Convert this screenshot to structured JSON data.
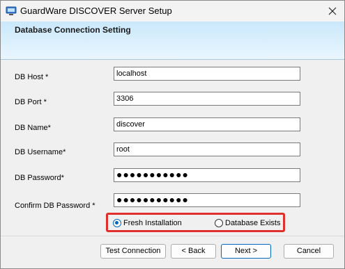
{
  "window": {
    "title": "GuardWare DISCOVER Server Setup",
    "header_title": "Database Connection Setting"
  },
  "form": {
    "host_label": "DB Host *",
    "host_value": "localhost",
    "port_label": "DB Port *",
    "port_value": "3306",
    "name_label": "DB Name*",
    "name_value": "discover",
    "username_label": "DB Username*",
    "username_value": "root",
    "password_label": "DB Password*",
    "password_value": "●●●●●●●●●●●",
    "confirm_label": "Confirm DB Password *",
    "confirm_value": "●●●●●●●●●●●"
  },
  "install_type": {
    "fresh_label": "Fresh Installation",
    "exists_label": "Database Exists",
    "selected": "Fresh Installation"
  },
  "buttons": {
    "test": "Test Connection",
    "back": "< Back",
    "next": "Next >",
    "cancel": "Cancel"
  },
  "colors": {
    "highlight_border": "#e0302e",
    "accent": "#0067c0"
  }
}
